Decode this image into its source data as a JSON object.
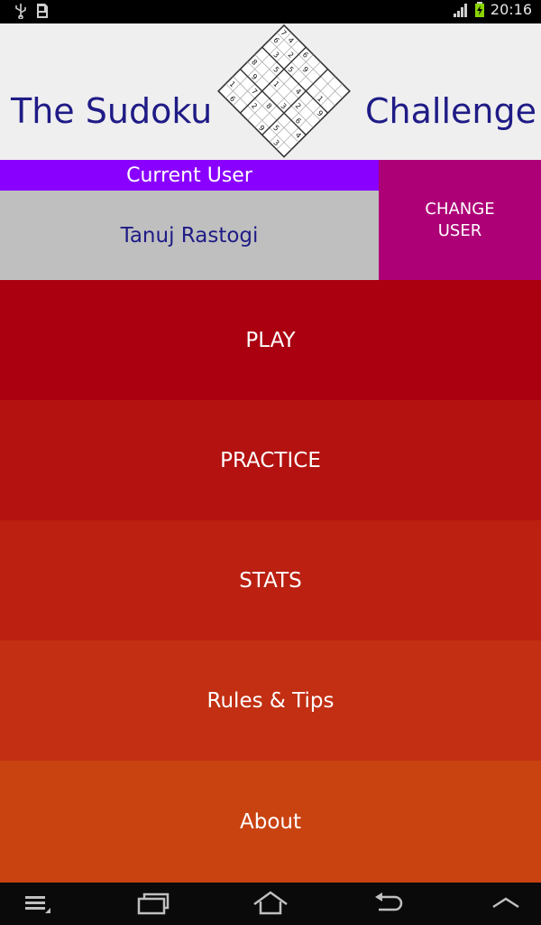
{
  "status_bar": {
    "time": "20:16",
    "left_icons": [
      "usb-icon",
      "sd-card-icon"
    ],
    "right_icons": [
      "signal-icon",
      "battery-icon"
    ]
  },
  "header": {
    "title_left": "The Sudoku",
    "title_right": "Challenge",
    "logo_icon": "sudoku-grid-icon"
  },
  "user_panel": {
    "label": "Current User",
    "username": "Tanuj Rastogi",
    "change_user_label": "CHANGE\nUSER"
  },
  "menu": {
    "items": [
      {
        "label": "PLAY",
        "color": "#aa0010"
      },
      {
        "label": "PRACTICE",
        "color": "#b31210"
      },
      {
        "label": "STATS",
        "color": "#bb2011"
      },
      {
        "label": "Rules & Tips",
        "color": "#c22f12"
      },
      {
        "label": "About",
        "color": "#c94310"
      }
    ]
  },
  "nav_bar": {
    "icons": [
      "menu-icon",
      "recent-apps-icon",
      "home-icon",
      "back-icon",
      "chevron-up-icon"
    ]
  },
  "colors": {
    "title_text": "#1f1b86",
    "current_user_bar": "#8a00ff",
    "username_bg": "#bfbfbf",
    "change_user_bg": "#ad0077"
  }
}
